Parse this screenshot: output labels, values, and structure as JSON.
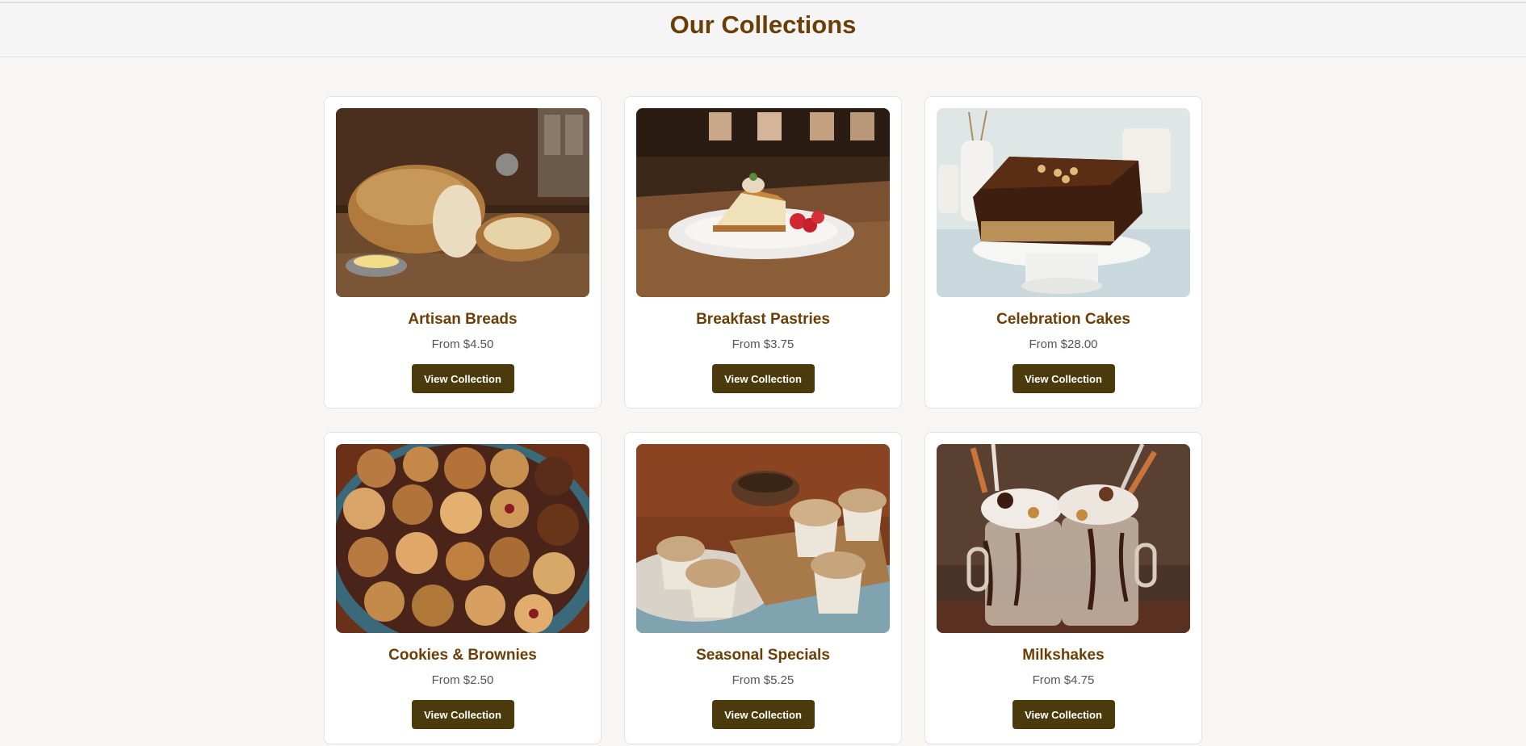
{
  "header": {
    "title": "Our Collections"
  },
  "collections": [
    {
      "name": "Artisan Breads",
      "price": "From $4.50",
      "button_label": "View Collection",
      "image": "artisan-bread-photo"
    },
    {
      "name": "Breakfast Pastries",
      "price": "From $3.75",
      "button_label": "View Collection",
      "image": "cheesecake-slice-photo"
    },
    {
      "name": "Celebration Cakes",
      "price": "From $28.00",
      "button_label": "View Collection",
      "image": "chocolate-cake-photo"
    },
    {
      "name": "Cookies & Brownies",
      "price": "From $2.50",
      "button_label": "View Collection",
      "image": "cookie-platter-photo"
    },
    {
      "name": "Seasonal Specials",
      "price": "From $5.25",
      "button_label": "View Collection",
      "image": "cupcakes-photo"
    },
    {
      "name": "Milkshakes",
      "price": "From $4.75",
      "button_label": "View Collection",
      "image": "milkshake-photo"
    }
  ],
  "colors": {
    "page_background": "#f7f6f2",
    "header_background": "#f5f5f5",
    "title": "#6b3e06",
    "price_text": "#555555",
    "button_background": "#4a3a0c",
    "button_text": "#ffffff"
  }
}
